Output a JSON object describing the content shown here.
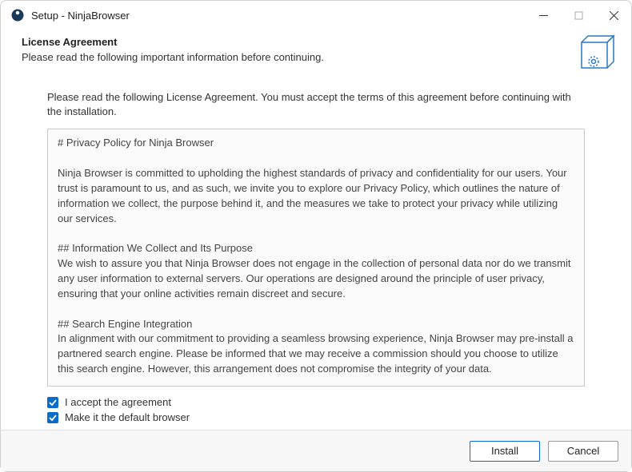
{
  "titlebar": {
    "title": "Setup - NinjaBrowser"
  },
  "header": {
    "title": "License Agreement",
    "subtitle": "Please read the following important information before continuing."
  },
  "content": {
    "instruction": "Please read the following License Agreement. You must accept the terms of this agreement before continuing with the installation.",
    "license_text": "# Privacy Policy for Ninja Browser\n\nNinja Browser is committed to upholding the highest standards of privacy and confidentiality for our users. Your trust is paramount to us, and as such, we invite you to explore our Privacy Policy, which outlines the nature of information we collect, the purpose behind it, and the measures we take to protect your privacy while utilizing our services.\n\n## Information We Collect and Its Purpose\nWe wish to assure you that Ninja Browser does not engage in the collection of personal data nor do we transmit any user information to external servers. Our operations are designed around the principle of user privacy, ensuring that your online activities remain discreet and secure.\n\n## Search Engine Integration\nIn alignment with our commitment to providing a seamless browsing experience, Ninja Browser may pre-install a partnered search engine. Please be informed that we may receive a commission should you choose to utilize this search engine. However, this arrangement does not compromise the integrity of your data."
  },
  "checks": {
    "accept": "I accept the agreement",
    "default": "Make it the default browser"
  },
  "footer": {
    "install": "Install",
    "cancel": "Cancel"
  }
}
